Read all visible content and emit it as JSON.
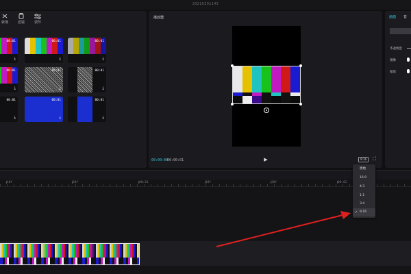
{
  "window": {
    "title": "20210201143"
  },
  "media": {
    "tabs": [
      {
        "label": "转场",
        "icon": "transition-icon"
      },
      {
        "label": "滤镜",
        "icon": "filter-icon"
      },
      {
        "label": "调节",
        "icon": "adjust-icon"
      }
    ],
    "items": [
      {
        "duration": "00:01",
        "kind": "bars"
      },
      {
        "duration": "00:01",
        "kind": "bars"
      },
      {
        "duration": "00:01",
        "kind": "bars"
      },
      {
        "duration": "00:01",
        "kind": "bars"
      },
      {
        "duration": "00:01",
        "kind": "noise"
      },
      {
        "duration": "00:01",
        "kind": "noise"
      },
      {
        "duration": "00:01",
        "kind": "dark"
      },
      {
        "duration": "00:01",
        "kind": "blue"
      },
      {
        "duration": "00:01",
        "kind": "blue"
      }
    ]
  },
  "player": {
    "title": "播放器",
    "current_time": "00:00:00",
    "total_time": "00:00:01",
    "ratio_label": "9:16"
  },
  "inspector": {
    "tabs": [
      "画面",
      "音"
    ],
    "labels": [
      "不透明度",
      "镜像",
      "缩放"
    ]
  },
  "timeline": {
    "ruler_ticks": [
      "10f",
      "20f",
      "00:01",
      "10f",
      "20f",
      "00:02"
    ]
  },
  "ratio_dropdown": {
    "options": [
      "原始",
      "16:9",
      "4:3",
      "1:1",
      "3:4",
      "9:16"
    ],
    "selected": "9:16"
  },
  "colors": {
    "accent": "#36c3d8",
    "annotation_arrow": "#e0201f"
  }
}
